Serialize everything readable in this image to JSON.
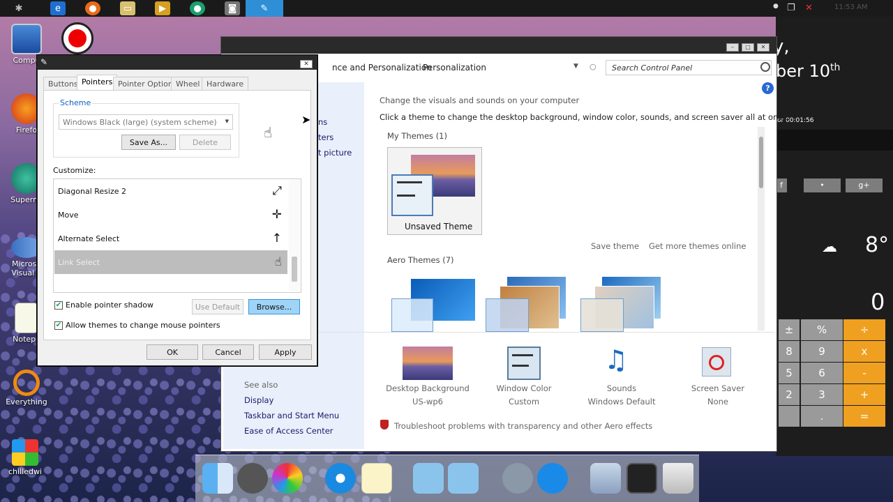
{
  "taskbar": {
    "icons": [
      "gear-icon",
      "ie-icon",
      "firefox-icon",
      "folder-icon",
      "media-icon",
      "superminer-icon",
      "camera-icon",
      "mouse-icon"
    ],
    "clock": "11:53 AM"
  },
  "desktop": {
    "icons": [
      {
        "label": "Compu",
        "icon": "computer-icon"
      },
      {
        "label": "Firefo",
        "icon": "firefox-icon"
      },
      {
        "label": "Supermi",
        "icon": "superminer-icon"
      },
      {
        "label": "Microso\nVisual S",
        "icon": "visual-studio-icon"
      },
      {
        "label": "Notepa",
        "icon": "notepad-icon"
      },
      {
        "label": "Everything",
        "icon": "magnifier-icon"
      },
      {
        "label": "chilledwi",
        "icon": "windows-icon"
      }
    ]
  },
  "widgets": {
    "date_line1": "y,",
    "date_line2": "ber 10",
    "date_sup": "th",
    "timer": "or 00:01:56",
    "social": [
      "f",
      "•",
      "g+"
    ],
    "temperature": "8°",
    "calc_display": "0",
    "calc_buttons": [
      [
        "±",
        "%",
        "÷"
      ],
      [
        "8",
        "9",
        "x"
      ],
      [
        "5",
        "6",
        "-"
      ],
      [
        "2",
        "3",
        "+"
      ],
      [
        "",
        ".",
        "="
      ]
    ]
  },
  "personalization": {
    "breadcrumb": [
      "nce and Personalization",
      "Personalization"
    ],
    "search_placeholder": "Search Control Panel",
    "heading": "Change the visuals and sounds on your computer",
    "subheading": "Click a theme to change the desktop background, window color, sounds, and screen saver all at once.",
    "left_links": [
      "ns",
      "ters",
      "t picture"
    ],
    "my_themes_label": "My Themes (1)",
    "unsaved_theme": "Unsaved Theme",
    "save_theme": "Save theme",
    "get_more": "Get more themes online",
    "aero_themes_label": "Aero Themes (7)",
    "see_also": "See also",
    "see_also_links": [
      "Display",
      "Taskbar and Start Menu",
      "Ease of Access Center"
    ],
    "bottom_items": [
      {
        "title": "Desktop Background",
        "value": "US-wp6"
      },
      {
        "title": "Window Color",
        "value": "Custom"
      },
      {
        "title": "Sounds",
        "value": "Windows Default"
      },
      {
        "title": "Screen Saver",
        "value": "None"
      }
    ],
    "troubleshoot": "Troubleshoot problems with transparency and other Aero effects"
  },
  "mouse_dialog": {
    "tabs": [
      "Buttons",
      "Pointers",
      "Pointer Options",
      "Wheel",
      "Hardware"
    ],
    "active_tab": "Pointers",
    "scheme_label": "Scheme",
    "scheme_value": "Windows Black (large) (system scheme)",
    "save_as": "Save As...",
    "delete": "Delete",
    "customize_label": "Customize:",
    "list_items": [
      {
        "label": "Diagonal Resize 2",
        "cursor": "⤢"
      },
      {
        "label": "Move",
        "cursor": "✛"
      },
      {
        "label": "Alternate Select",
        "cursor": "↑"
      },
      {
        "label": "Link Select",
        "cursor": "☝"
      }
    ],
    "enable_shadow": "Enable pointer shadow",
    "allow_themes": "Allow themes to change mouse pointers",
    "use_default": "Use Default",
    "browse": "Browse...",
    "ok": "OK",
    "cancel": "Cancel",
    "apply": "Apply"
  },
  "dock": {
    "icons": [
      "finder-icon",
      "settings-icon",
      "color-icon",
      "safari-icon",
      "notes-icon",
      "folder-icon",
      "folder-icon",
      "rocket-icon",
      "appstore-icon",
      "preview-icon",
      "photo-icon",
      "trash-icon"
    ]
  }
}
